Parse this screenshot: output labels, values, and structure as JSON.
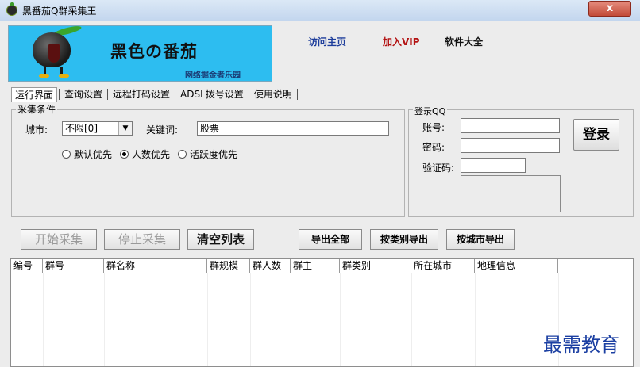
{
  "window": {
    "title": "黑番茄Q群采集王",
    "close_label": "x"
  },
  "banner": {
    "title": "黑色の番茄",
    "subtitle": "网络掘金者乐园"
  },
  "links": {
    "home": "访问主页",
    "vip": "加入VIP",
    "software": "软件大全"
  },
  "tabs": [
    {
      "label": "运行界面",
      "active": true
    },
    {
      "label": "查询设置",
      "active": false
    },
    {
      "label": "远程打码设置",
      "active": false
    },
    {
      "label": "ADSL拨号设置",
      "active": false
    },
    {
      "label": "使用说明",
      "active": false
    }
  ],
  "collect": {
    "group_title": "采集条件",
    "city_label": "城市:",
    "city_value": "不限[0]",
    "keyword_label": "关键词:",
    "keyword_value": "股票",
    "radios": [
      {
        "label": "默认优先",
        "checked": false
      },
      {
        "label": "人数优先",
        "checked": true
      },
      {
        "label": "活跃度优先",
        "checked": false
      }
    ]
  },
  "login": {
    "group_title": "登录QQ",
    "account_label": "账号:",
    "password_label": "密码:",
    "captcha_label": "验证码:",
    "button_label": "登录"
  },
  "actions": {
    "start": "开始采集",
    "stop": "停止采集",
    "clear": "清空列表",
    "export_all": "导出全部",
    "export_by_category": "按类别导出",
    "export_by_city": "按城市导出"
  },
  "table": {
    "columns": [
      "编号",
      "群号",
      "群名称",
      "群规模",
      "群人数",
      "群主",
      "群类别",
      "所在城市",
      "地理信息"
    ],
    "rows": []
  },
  "watermark": "最需教育",
  "colors": {
    "banner": "#2dbdf0",
    "vip_link": "#b31212",
    "home_link": "#1d3d9b",
    "watermark": "#1b3fa2"
  }
}
